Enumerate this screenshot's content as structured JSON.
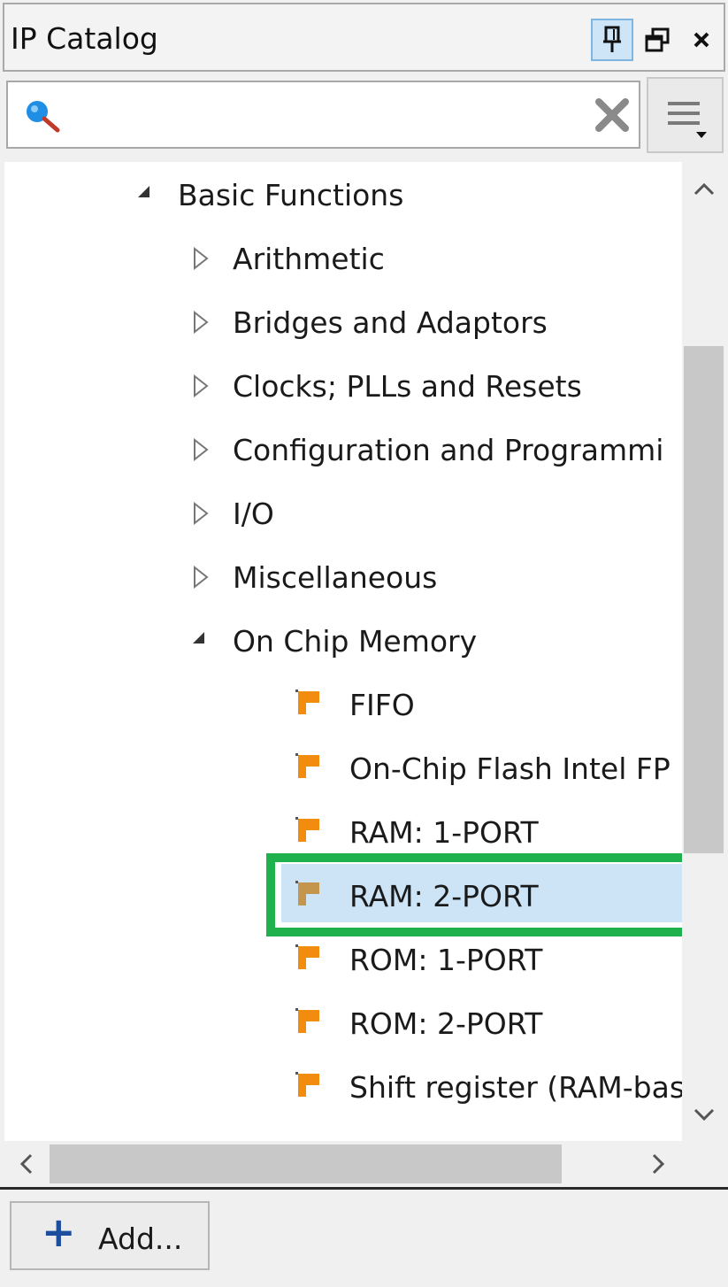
{
  "panel": {
    "title": "IP Catalog"
  },
  "search": {
    "value": "",
    "placeholder": ""
  },
  "tree": {
    "items": [
      {
        "label": "Basic Functions",
        "state": "expanded"
      },
      {
        "label": "Arithmetic",
        "state": "collapsed"
      },
      {
        "label": "Bridges and Adaptors",
        "state": "collapsed"
      },
      {
        "label": "Clocks; PLLs and Resets",
        "state": "collapsed"
      },
      {
        "label": "Configuration and Programmi",
        "state": "collapsed"
      },
      {
        "label": "I/O",
        "state": "collapsed"
      },
      {
        "label": "Miscellaneous",
        "state": "collapsed"
      },
      {
        "label": "On Chip Memory",
        "state": "expanded"
      },
      {
        "label": "FIFO",
        "state": "leaf"
      },
      {
        "label": "On-Chip Flash Intel FP",
        "state": "leaf"
      },
      {
        "label": "RAM: 1-PORT",
        "state": "leaf"
      },
      {
        "label": "RAM: 2-PORT",
        "state": "leaf-selected"
      },
      {
        "label": "ROM: 1-PORT",
        "state": "leaf"
      },
      {
        "label": "ROM: 2-PORT",
        "state": "leaf"
      },
      {
        "label": "Shift register (RAM-bas",
        "state": "leaf"
      }
    ]
  },
  "footer": {
    "add_label": "Add...",
    "add_symbol": "+"
  },
  "colors": {
    "selection": "#cce4f6",
    "highlight": "#1fb14b",
    "leaf_icon": "#f28c0f",
    "add_icon": "#1d4e9e"
  }
}
